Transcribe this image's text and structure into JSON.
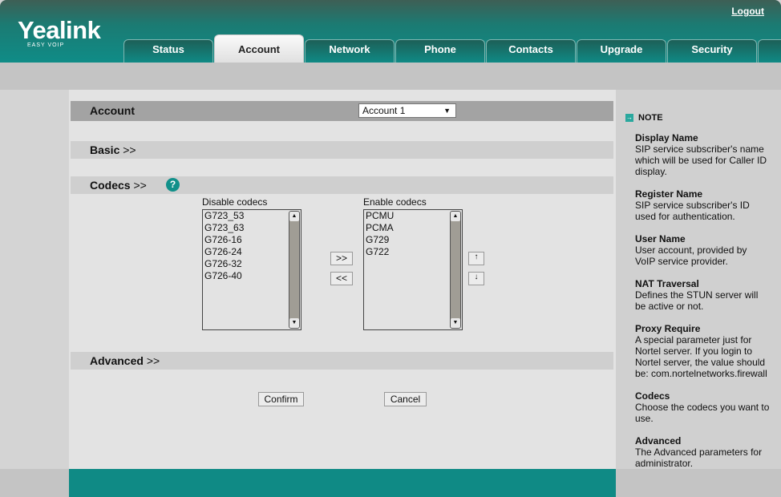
{
  "header": {
    "logo": "Yealink",
    "logo_sub": "EASY VOIP",
    "logout": "Logout",
    "tabs": [
      {
        "label": "Status"
      },
      {
        "label": "Account"
      },
      {
        "label": "Network"
      },
      {
        "label": "Phone"
      },
      {
        "label": "Contacts"
      },
      {
        "label": "Upgrade"
      },
      {
        "label": "Security"
      }
    ],
    "active_tab": "Account"
  },
  "account": {
    "title": "Account",
    "selected": "Account 1"
  },
  "basic": {
    "title": "Basic",
    "arrow": ">>"
  },
  "codecs": {
    "title": "Codecs",
    "arrow": ">>",
    "help": "?",
    "disable_label": "Disable codecs",
    "enable_label": "Enable codecs",
    "disabled": [
      "G723_53",
      "G723_63",
      "G726-16",
      "G726-24",
      "G726-32",
      "G726-40"
    ],
    "enabled": [
      "PCMU",
      "PCMA",
      "G729",
      "G722"
    ],
    "add": ">>",
    "remove": "<<",
    "up": "↑",
    "down": "↓"
  },
  "advanced": {
    "title": "Advanced",
    "arrow": ">>"
  },
  "actions": {
    "confirm": "Confirm",
    "cancel": "Cancel"
  },
  "note": {
    "title": "NOTE",
    "items": [
      {
        "title": "Display Name",
        "text": "SIP service subscriber's name which will be used for Caller ID display."
      },
      {
        "title": "Register Name",
        "text": "SIP service subscriber's ID used for authentication."
      },
      {
        "title": "User Name",
        "text": "User account, provided by VoIP service provider."
      },
      {
        "title": "NAT Traversal",
        "text": "Defines the STUN server will be active or not."
      },
      {
        "title": "Proxy Require",
        "text": "A special parameter just for Nortel server. If you login to Nortel server, the value should be: com.nortelnetworks.firewall"
      },
      {
        "title": "Codecs",
        "text": "Choose the codecs you want to use."
      },
      {
        "title": "Advanced",
        "text": "The Advanced parameters for administrator."
      }
    ]
  }
}
